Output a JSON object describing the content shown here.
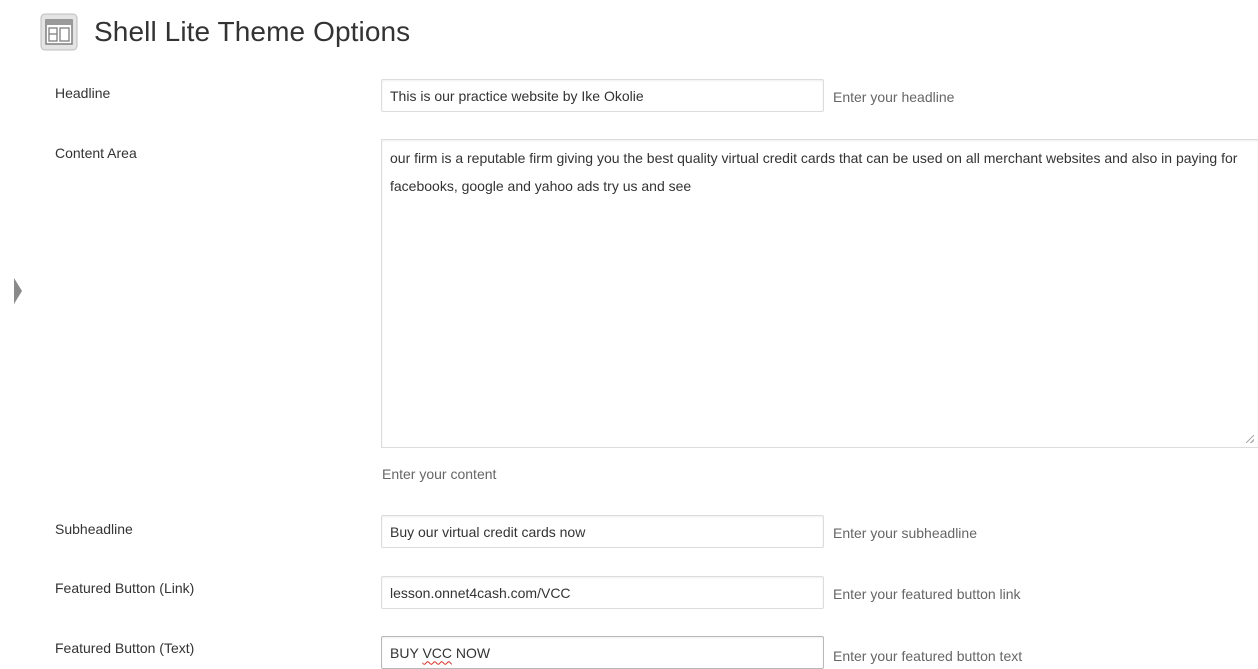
{
  "header": {
    "title": "Shell Lite Theme Options",
    "icon": "theme-options-icon"
  },
  "sidebar": {
    "collapse_icon": "triangle-right-icon"
  },
  "fields": {
    "headline": {
      "label": "Headline",
      "value": "This is our practice website by Ike Okolie",
      "description": "Enter your headline"
    },
    "content_area": {
      "label": "Content Area",
      "value": "our firm is a reputable firm giving you the best quality virtual credit cards that can be used on all merchant websites and also in paying for facebooks, google and yahoo ads try us and see",
      "description": "Enter your content"
    },
    "subheadline": {
      "label": "Subheadline",
      "value": "Buy our virtual credit cards now",
      "description": "Enter your subheadline"
    },
    "featured_button_link": {
      "label": "Featured Button (Link)",
      "value": "lesson.onnet4cash.com/VCC",
      "description": "Enter your featured button link"
    },
    "featured_button_text": {
      "label": "Featured Button (Text)",
      "value_before": "BUY ",
      "value_misspelled": "VCC",
      "value_after": " NOW",
      "description": "Enter your featured button text"
    }
  },
  "colors": {
    "text": "#333333",
    "description": "#666666",
    "input_border": "#dcdcdc",
    "spellcheck": "#d62d20"
  }
}
